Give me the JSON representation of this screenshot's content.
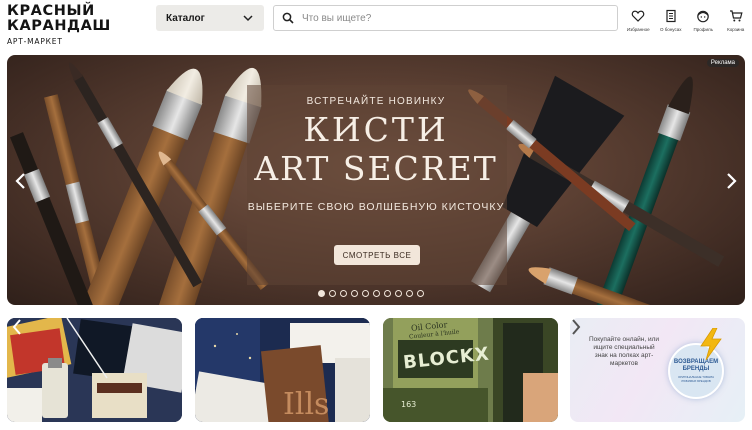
{
  "header": {
    "logo": {
      "line1": "КРАСНЫЙ",
      "line2": "КАРАНДАШ",
      "line3": "АРТ-МАРКЕТ"
    },
    "catalog_label": "Каталог",
    "search": {
      "placeholder": "Что вы ищете?",
      "value": ""
    },
    "icons": [
      {
        "icon": "heart-icon",
        "label": "Избранное"
      },
      {
        "icon": "bonus-card-icon",
        "label": "О бонусах"
      },
      {
        "icon": "profile-icon",
        "label": "Профиль"
      },
      {
        "icon": "cart-icon",
        "label": "Корзина"
      }
    ]
  },
  "banner": {
    "ad_label": "Реклама",
    "kicker": "ВСТРЕЧАЙТЕ НОВИНКУ",
    "title_line1": "КИСТИ",
    "title_line2": "ART SECRET",
    "subtitle": "ВЫБЕРИТЕ СВОЮ ВОЛШЕБНУЮ КИСТОЧКУ",
    "cta": "СМОТРЕТЬ ВСЕ",
    "slides_total": 10,
    "active_slide": 1
  },
  "tiles": [
    {
      "name": "art-supplies-promo"
    },
    {
      "name": "sketchbooks-promo"
    },
    {
      "name": "blockx-oil-color-promo",
      "brand": "BLOCKX",
      "product_line1": "Oil Color",
      "product_line2": "Couleur à l'huile",
      "number": "163"
    },
    {
      "name": "returning-brands-promo",
      "text": "Покупайте онлайн, или ищите специальный знак на полках арт-маркетов",
      "badge_title": "ВОЗВРАЩАЕМ БРЕНДЫ",
      "badge_small": "ОРИГИНАЛЬНЫЕ ТОВАРЫ ЛЮБИМЫХ БРЕНДОВ"
    }
  ],
  "colors": {
    "banner_bg": "#5c4033",
    "cta_bg": "#f2e6da",
    "catalog_bg": "#ecebe8",
    "badge_blue": "#2e5b94"
  }
}
